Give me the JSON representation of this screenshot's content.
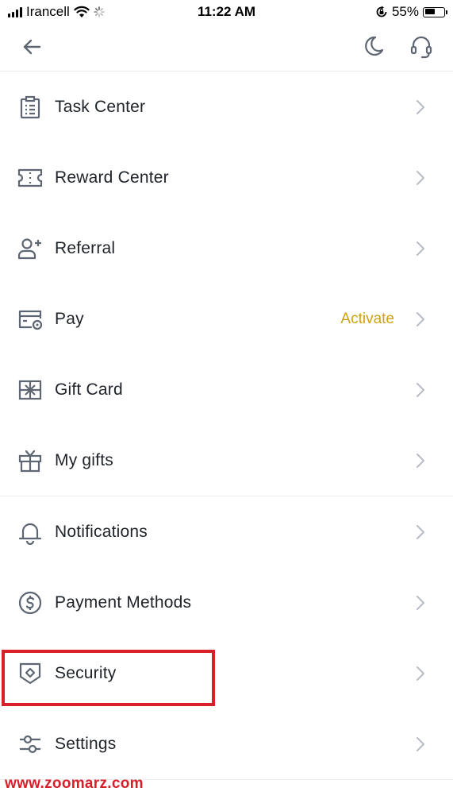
{
  "status_bar": {
    "carrier": "Irancell",
    "time": "11:22 AM",
    "battery": "55%",
    "battery_level": 0.55,
    "icons": [
      "signal-icon",
      "wifi-icon",
      "loading-icon",
      "rotation-lock-icon",
      "battery-icon"
    ]
  },
  "topbar": {
    "icons": [
      "back-arrow-icon",
      "moon-icon",
      "headset-icon"
    ]
  },
  "menu": {
    "items": [
      {
        "label": "Task Center",
        "icon": "task-clipboard-icon"
      },
      {
        "label": "Reward Center",
        "icon": "ticket-icon"
      },
      {
        "label": "Referral",
        "icon": "add-user-icon"
      },
      {
        "label": "Pay",
        "icon": "pay-card-icon",
        "extra": "Activate"
      },
      {
        "label": "Gift Card",
        "icon": "gift-card-icon"
      },
      {
        "label": "My gifts",
        "icon": "gift-box-icon"
      },
      {
        "label": "Notifications",
        "icon": "bell-icon"
      },
      {
        "label": "Payment Methods",
        "icon": "dollar-circle-icon"
      },
      {
        "label": "Security",
        "icon": "shield-icon"
      },
      {
        "label": "Settings",
        "icon": "sliders-icon"
      }
    ]
  },
  "colors": {
    "accent": "#d0a20f",
    "highlight": "#d9202a",
    "icon": "#5e6673",
    "chevron": "#b7bdc6",
    "text": "#1e2329"
  },
  "watermark": "www.zoomarz.com"
}
